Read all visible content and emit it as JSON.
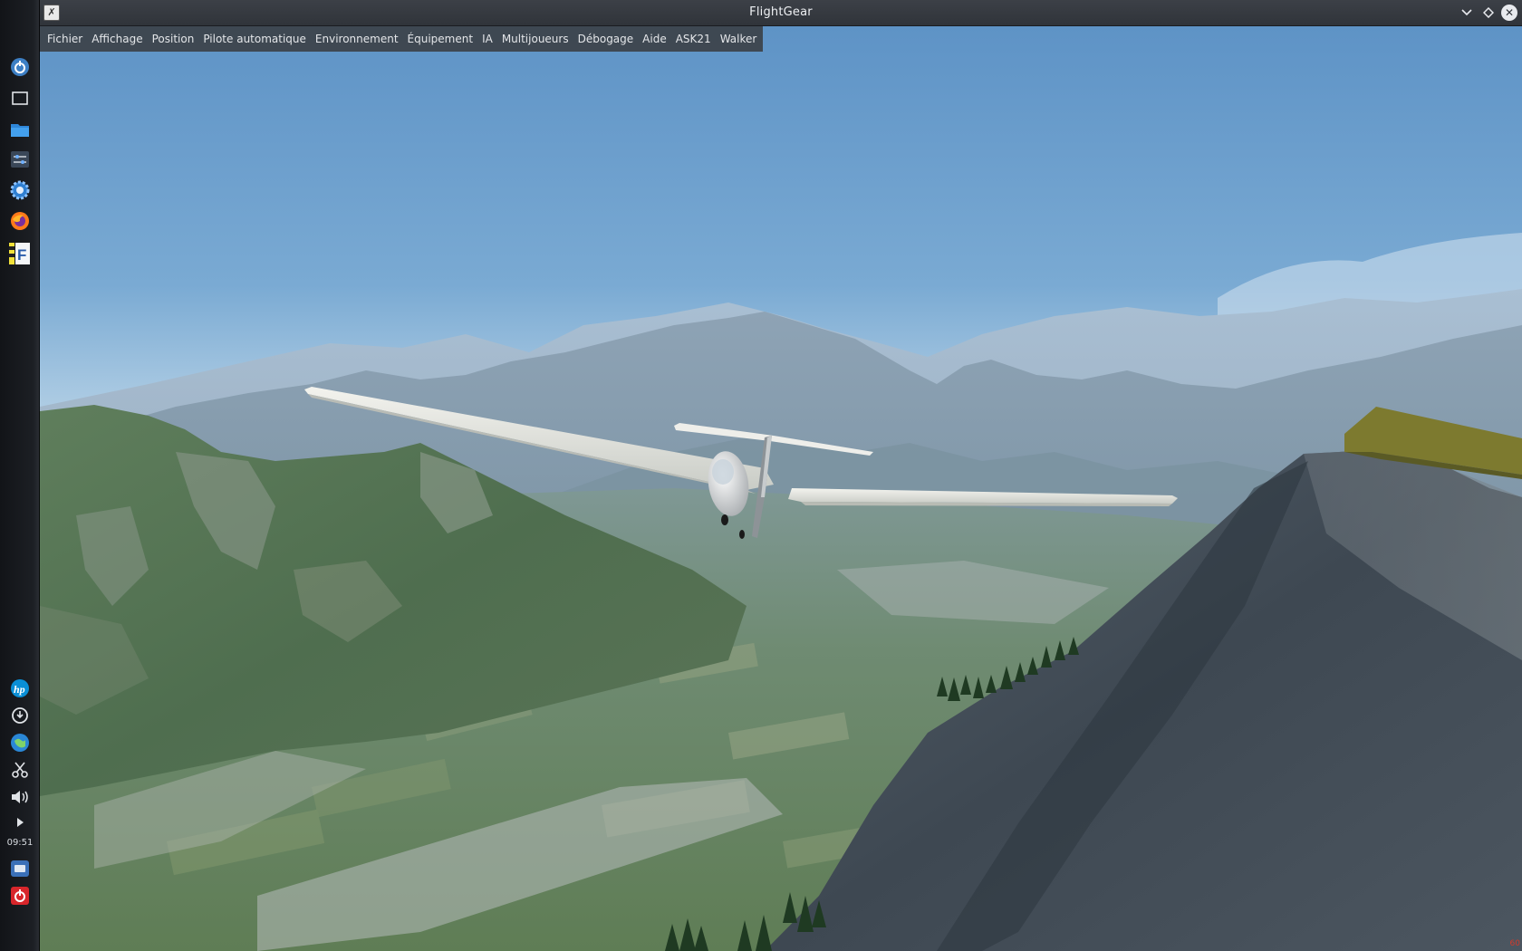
{
  "window": {
    "title": "FlightGear"
  },
  "menubar": {
    "items": [
      {
        "id": "fichier",
        "label": "Fichier"
      },
      {
        "id": "affichage",
        "label": "Affichage"
      },
      {
        "id": "position",
        "label": "Position"
      },
      {
        "id": "pilote-automatique",
        "label": "Pilote automatique"
      },
      {
        "id": "environnement",
        "label": "Environnement"
      },
      {
        "id": "equipement",
        "label": "Équipement"
      },
      {
        "id": "ia",
        "label": "IA"
      },
      {
        "id": "multijoueurs",
        "label": "Multijoueurs"
      },
      {
        "id": "debogage",
        "label": "Débogage"
      },
      {
        "id": "aide",
        "label": "Aide"
      },
      {
        "id": "ask21",
        "label": "ASK21"
      },
      {
        "id": "walker",
        "label": "Walker"
      }
    ]
  },
  "taskbar": {
    "top_icons": [
      "app-launcher-icon",
      "desktop-icon",
      "file-manager-icon",
      "system-settings-icon",
      "settings-gear-icon",
      "firefox-icon",
      "flightgear-icon"
    ],
    "bottom_icons": [
      "hp-icon",
      "update-icon",
      "network-icon",
      "scissors-icon",
      "volume-icon",
      "expand-arrow-icon"
    ],
    "clock": "09:51",
    "bottom_end_icons": [
      "storage-icon",
      "power-icon"
    ]
  },
  "viewport": {
    "scene": "glider-over-alpine-valley",
    "fps_counter": "60"
  }
}
